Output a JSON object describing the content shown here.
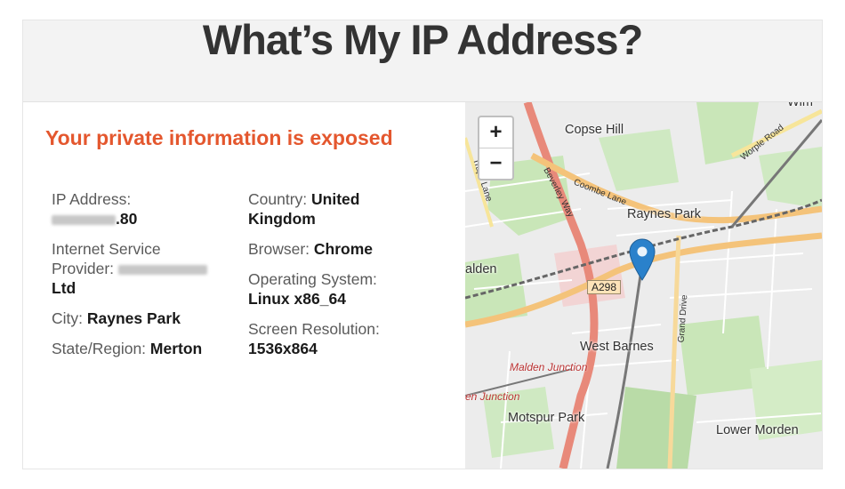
{
  "page": {
    "title": "What’s My IP Address?"
  },
  "info": {
    "warning": "Your private information is exposed",
    "left": [
      {
        "label": "IP Address:",
        "value": ".80",
        "redacted_prefix": true
      },
      {
        "label": "Internet Service Provider:",
        "value": "Ltd",
        "redacted_middle": true
      },
      {
        "label": "City:",
        "value": "Raynes Park"
      },
      {
        "label": "State/Region:",
        "value": "Merton"
      }
    ],
    "right": [
      {
        "label": "Country:",
        "value": "United Kingdom"
      },
      {
        "label": "Browser:",
        "value": "Chrome"
      },
      {
        "label": "Operating System:",
        "value": "Linux x86_64"
      },
      {
        "label": "Screen Resolution:",
        "value": "1536x864"
      }
    ]
  },
  "map": {
    "zoom_in": "+",
    "zoom_out": "−",
    "places": {
      "copse_hill": "Copse Hill",
      "raynes_park": "Raynes Park",
      "malden": "alden",
      "west_barnes": "West Barnes",
      "motspur_park": "Motspur Park",
      "lower_morden": "Lower Morden",
      "corner": "Wim"
    },
    "stations": {
      "malden_junction": "Malden Junction",
      "junction": "en Junction"
    },
    "roads": {
      "a298": "A298",
      "coombe_lane": "Coombe Lane",
      "beverley_way": "Beverley Way",
      "grand_drive": "Grand Drive",
      "worple_road": "Worple Road",
      "traps_lane": "Traps Lane"
    },
    "marker_color": "#2a81cb"
  },
  "colors": {
    "accent": "#e4572e",
    "marker": "#2a81cb"
  }
}
